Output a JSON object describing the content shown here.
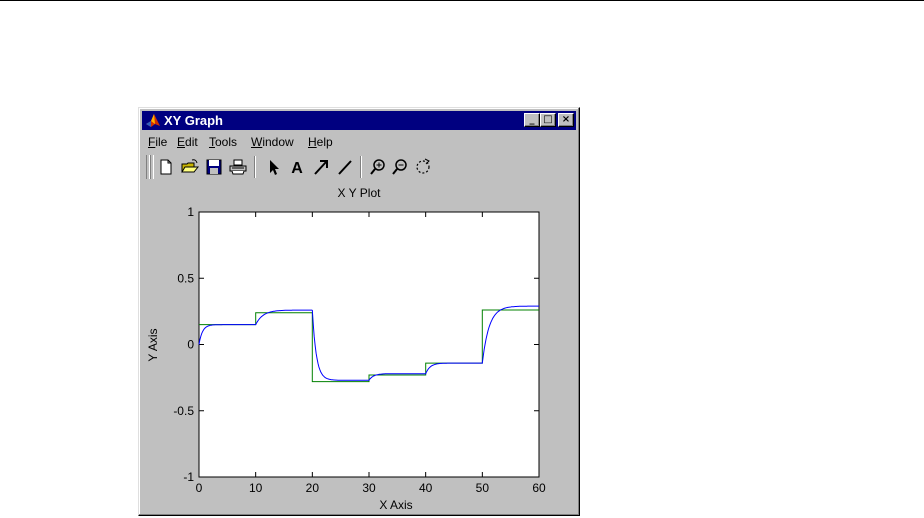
{
  "window": {
    "title": "XY Graph",
    "caption_buttons": {
      "minimize": "_",
      "maximize": "□",
      "close": "×"
    }
  },
  "menu": {
    "items": [
      {
        "label": "File",
        "mnemonic": "F"
      },
      {
        "label": "Edit",
        "mnemonic": "E"
      },
      {
        "label": "Tools",
        "mnemonic": "T"
      },
      {
        "label": "Window",
        "mnemonic": "W"
      },
      {
        "label": "Help",
        "mnemonic": "H"
      }
    ]
  },
  "toolbar": {
    "buttons": [
      "new-file-icon",
      "open-folder-icon",
      "save-icon",
      "print-icon",
      "select-arrow-icon",
      "insert-text-icon",
      "insert-arrow-icon",
      "insert-line-icon",
      "zoom-in-icon",
      "zoom-out-icon",
      "rotate-icon"
    ],
    "text_tool_glyph": "A"
  },
  "chart_data": {
    "type": "line",
    "title": "X Y Plot",
    "xlabel": "X Axis",
    "ylabel": "Y Axis",
    "xlim": [
      0,
      60
    ],
    "ylim": [
      -1,
      1
    ],
    "xticks": [
      0,
      10,
      20,
      30,
      40,
      50,
      60
    ],
    "yticks": [
      -1,
      -0.5,
      0,
      0.5,
      1
    ],
    "ytick_labels": [
      "-1",
      "-0.5",
      "0",
      "0.5",
      "1"
    ],
    "grid": false,
    "series": [
      {
        "color": "#008000",
        "style": "step",
        "x": [
          0,
          10,
          10,
          20,
          20,
          30,
          30,
          40,
          40,
          50,
          50,
          60
        ],
        "y": [
          0.15,
          0.15,
          0.24,
          0.24,
          -0.28,
          -0.28,
          -0.23,
          -0.23,
          -0.14,
          -0.14,
          0.26,
          0.26
        ]
      },
      {
        "color": "#0000ff",
        "style": "smooth",
        "segments": [
          {
            "x0": 0,
            "x1": 10,
            "y_start": 0.0,
            "y_end": 0.15,
            "tau": 0.6
          },
          {
            "x0": 10,
            "x1": 20,
            "y_start": 0.15,
            "y_end": 0.26,
            "tau": 1.3
          },
          {
            "x0": 20,
            "x1": 30,
            "y_start": 0.26,
            "y_end": -0.27,
            "tau": 0.7
          },
          {
            "x0": 30,
            "x1": 40,
            "y_start": -0.27,
            "y_end": -0.22,
            "tau": 0.8
          },
          {
            "x0": 40,
            "x1": 50,
            "y_start": -0.22,
            "y_end": -0.14,
            "tau": 0.8
          },
          {
            "x0": 50,
            "x1": 60,
            "y_start": -0.14,
            "y_end": 0.29,
            "tau": 1.2
          }
        ]
      }
    ]
  }
}
